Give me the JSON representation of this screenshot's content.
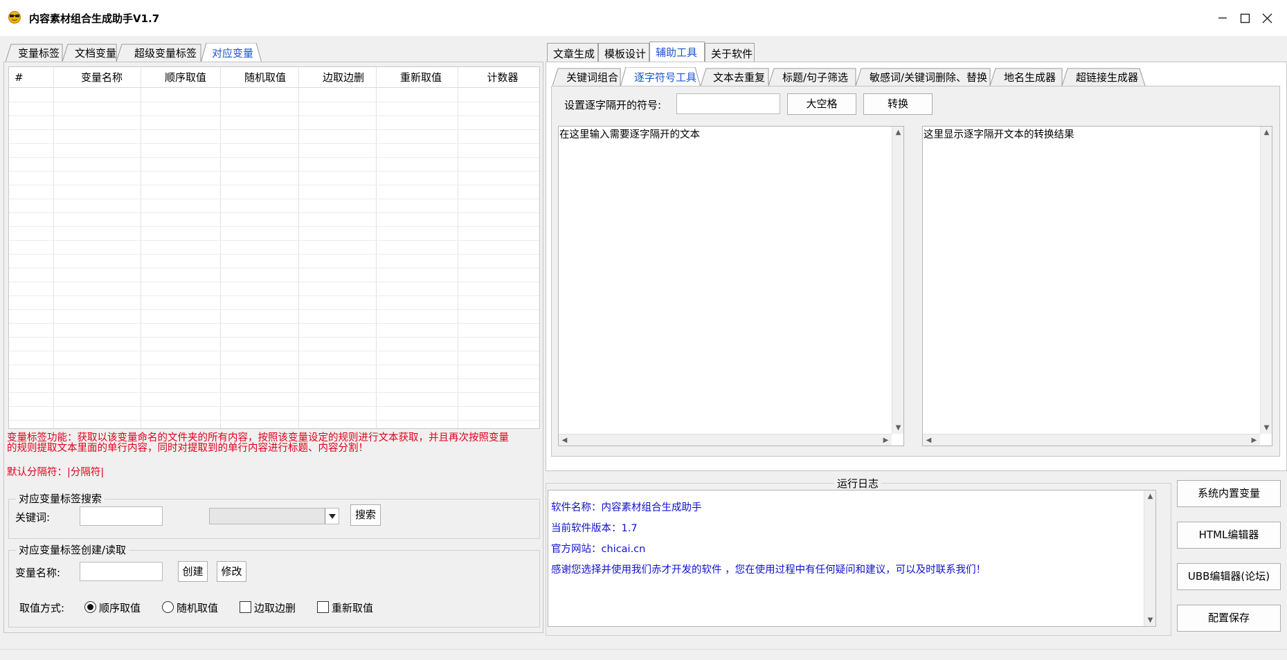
{
  "window": {
    "title": "内容素材组合生成助手V1.7",
    "controls": {
      "minimize": "─",
      "maximize": "☐",
      "close": "✕"
    }
  },
  "left_tabs": [
    "变量标签",
    "文档变量",
    "超级变量标签",
    "对应变量"
  ],
  "left_active_tab": 3,
  "grid": {
    "columns": [
      "#",
      "变量名称",
      "顺序取值",
      "随机取值",
      "边取边删",
      "重新取值",
      "计数器"
    ],
    "rows": []
  },
  "description": {
    "line1": "变量标签功能：获取以该变量命名的文件夹的所有内容，按照该变量设定的规则进行文本获取，并且再次按照变量",
    "line2": "的规则提取文本里面的单行内容，同时对提取到的单行内容进行标题、内容分割！",
    "separator": "默认分隔符：|分隔符|"
  },
  "search_group": {
    "legend": "对应变量标签搜索",
    "keyword_label": "关键词:",
    "keyword_value": "",
    "dropdown_value": "",
    "search_button": "搜索"
  },
  "create_group": {
    "legend": "对应变量标签创建/读取",
    "name_label": "变量名称:",
    "name_value": "",
    "create_button": "创建",
    "modify_button": "修改",
    "mode_label": "取值方式:",
    "options": {
      "sequential": "顺序取值",
      "random": "随机取值",
      "take_delete": "边取边删",
      "retake": "重新取值"
    }
  },
  "right_tabs": [
    "文章生成",
    "模板设计",
    "辅助工具",
    "关于软件"
  ],
  "right_active_tab": 2,
  "sub_tabs": [
    "关键词组合",
    "逐字符号工具",
    "文本去重复",
    "标题/句子筛选",
    "敏感词/关键词删除、替换",
    "地名生成器",
    "超链接生成器"
  ],
  "sub_active_tab": 1,
  "tool": {
    "symbol_label": "设置逐字隔开的符号:",
    "symbol_value": "",
    "space_button": "大空格",
    "convert_button": "转换",
    "input_text": "在这里输入需要逐字隔开的文本",
    "output_text": "这里显示逐字隔开文本的转换结果"
  },
  "log": {
    "title": "运行日志",
    "lines": [
      "软件名称：内容素材组合生成助手",
      "当前软件版本：1.7",
      "官方网站：chicai.cn",
      "感谢您选择并使用我们赤才开发的软件 ，您在使用过程中有任何疑问和建议，可以及时联系我们！"
    ]
  },
  "side_buttons": [
    "系统内置变量",
    "HTML编辑器",
    "UBB编辑器(论坛)",
    "配置保存"
  ]
}
